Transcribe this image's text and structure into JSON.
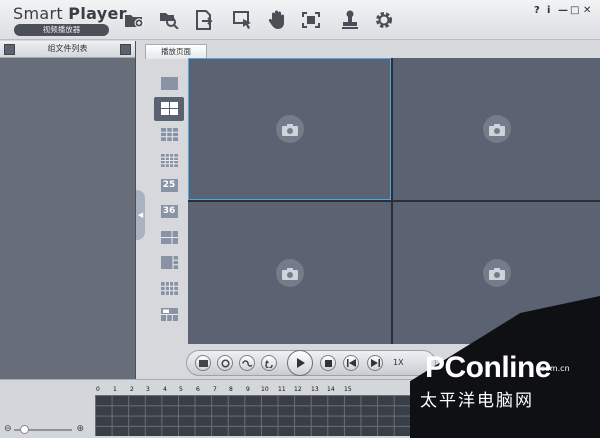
{
  "app": {
    "name_light": "Smart ",
    "name_bold": "Player",
    "subtitle": "视频播放器"
  },
  "toolbar": {
    "buttons": [
      "open-folder-icon",
      "search-file-icon",
      "export-icon",
      "select-area-icon",
      "hand-icon",
      "fullscreen-icon",
      "stamp-icon",
      "settings-icon"
    ]
  },
  "window_controls": [
    "?",
    "i",
    "—",
    "□",
    "✕"
  ],
  "left_panel": {
    "title": "组文件列表"
  },
  "tabs": [
    {
      "label": "播放页面"
    }
  ],
  "layouts": [
    "1",
    "4",
    "9",
    "16",
    "25",
    "36",
    "mixed-a",
    "mixed-b",
    "mixed-c",
    "mixed-d"
  ],
  "layout_number_labels": {
    "l25": "25",
    "l36": "36"
  },
  "playback": {
    "speed": "1X"
  },
  "timeline": {
    "ticks": [
      "0",
      "1",
      "2",
      "3",
      "4",
      "5",
      "6",
      "7",
      "8",
      "9",
      "10",
      "11",
      "12",
      "13",
      "14",
      "15"
    ]
  },
  "watermark": {
    "logo": "PConline",
    "domain": ".com.cn",
    "cn": "太平洋电脑网"
  }
}
